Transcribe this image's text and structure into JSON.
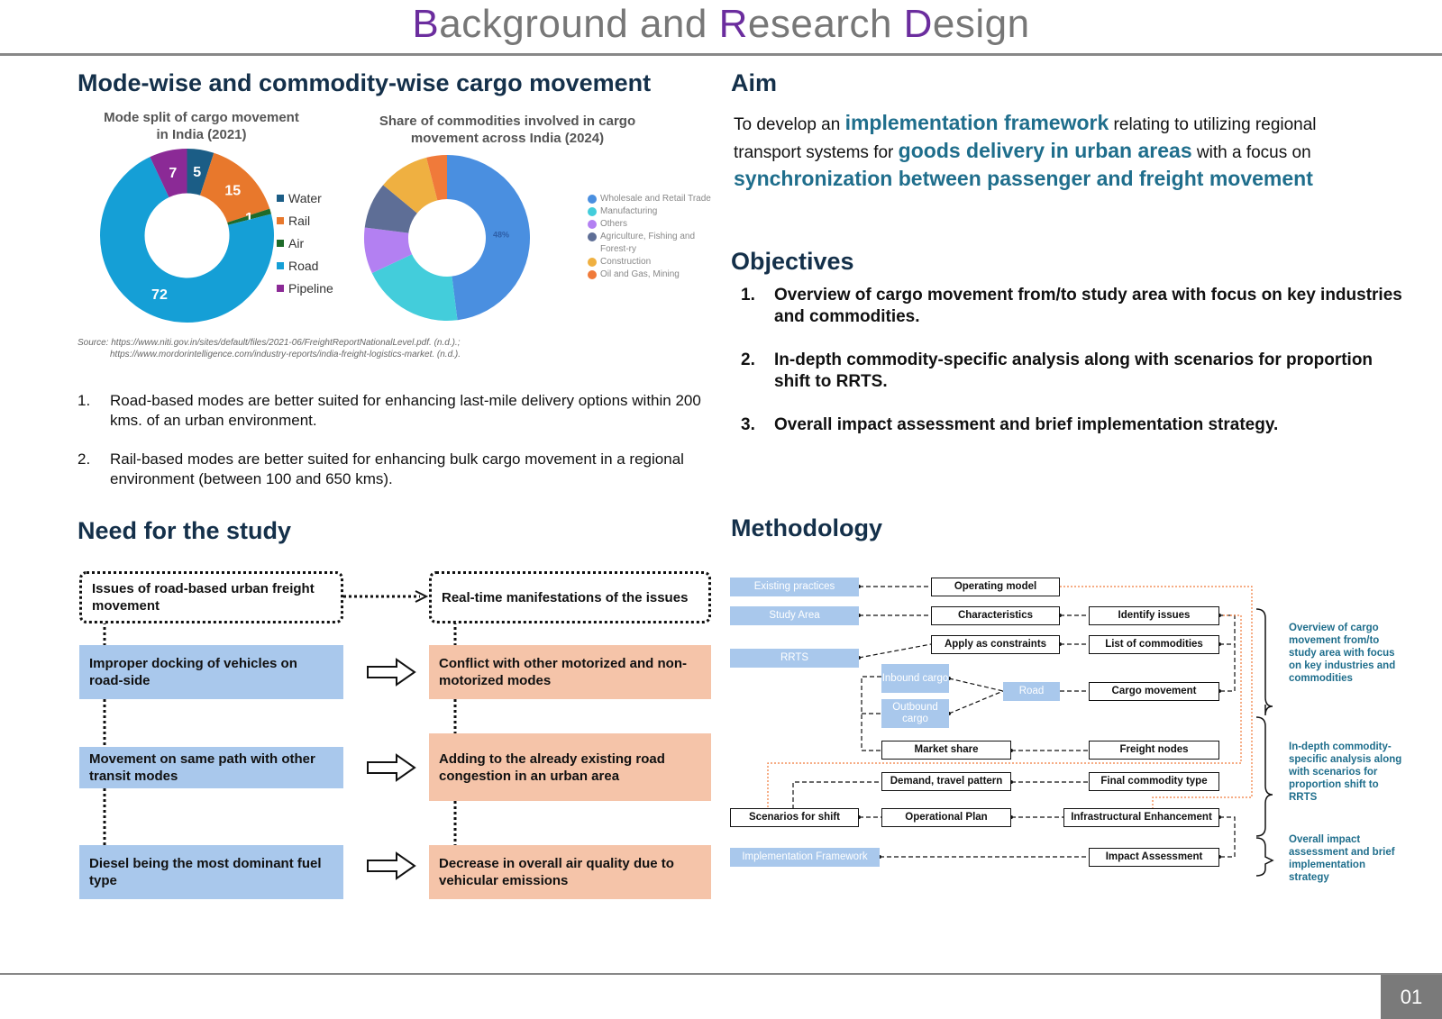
{
  "header": {
    "title_parts": [
      {
        "t": "B",
        "accent": true
      },
      {
        "t": "ackground and ",
        "accent": false
      },
      {
        "t": "R",
        "accent": true
      },
      {
        "t": "esearch ",
        "accent": false
      },
      {
        "t": "D",
        "accent": true
      },
      {
        "t": "esign",
        "accent": false
      }
    ]
  },
  "left_top": {
    "heading": "Mode-wise and commodity-wise cargo movement",
    "source_line1": "Source: https://www.niti.gov.in/sites/default/files/2021-06/FreightReportNationalLevel.pdf. (n.d.).;",
    "source_line2": "https://www.mordorintelligence.com/industry-reports/india-freight-logistics-market. (n.d.).",
    "points": [
      {
        "num": "1.",
        "text": "Road-based modes are better suited for enhancing last-mile delivery options within 200 kms. of an urban environment."
      },
      {
        "num": "2.",
        "text": "Rail-based modes are better suited for enhancing bulk cargo movement in a regional environment (between 100 and 650 kms)."
      }
    ]
  },
  "chart_data": [
    {
      "type": "pie",
      "title_line1": "Mode split of cargo movement",
      "title_line2": "in India (2021)",
      "categories": [
        "Water",
        "Rail",
        "Air",
        "Road",
        "Pipeline"
      ],
      "values": [
        5,
        15,
        1,
        72,
        7
      ],
      "labels": [
        "5",
        "15",
        "1",
        "72",
        "7"
      ],
      "colors": [
        "#1b5d86",
        "#e8782c",
        "#1e6b2a",
        "#159fd6",
        "#8b2a96"
      ],
      "legend_position": "right"
    },
    {
      "type": "pie",
      "title_line1": "Share of commodities involved in cargo",
      "title_line2": "movement across India (2024)",
      "categories": [
        "Wholesale and Retail Trade",
        "Manufacturing",
        "Others",
        "Agriculture, Fishing and Forest-ry",
        "Construction",
        "Oil and Gas, Mining"
      ],
      "values": [
        48,
        20,
        9,
        9,
        10,
        4
      ],
      "labels": [
        "48%",
        "",
        "",
        "",
        "",
        ""
      ],
      "colors": [
        "#4a8fe0",
        "#43cddb",
        "#b380f2",
        "#5e6e96",
        "#efb041",
        "#f07a3a"
      ],
      "legend_position": "right"
    }
  ],
  "need": {
    "heading": "Need for the study",
    "left_header": "Issues of road-based urban freight movement",
    "right_header": "Real-time manifestations of the issues",
    "rows": [
      {
        "issue": "Improper docking of vehicles on road-side",
        "effect": "Conflict with other motorized and non-motorized modes"
      },
      {
        "issue": "Movement on same path with other transit modes",
        "effect": "Adding to the already existing road congestion in an urban area"
      },
      {
        "issue": "Diesel being the most dominant fuel type",
        "effect": "Decrease in overall air quality due to vehicular emissions"
      }
    ]
  },
  "aim": {
    "heading": "Aim",
    "p1": "To develop an ",
    "h1": "implementation framework",
    "p2": " relating to utilizing regional transport systems for ",
    "h2": "goods delivery in urban areas",
    "p3": " with a focus on ",
    "h3": "synchronization between passenger and freight movement"
  },
  "objectives": {
    "heading": "Objectives",
    "items": [
      {
        "num": "1.",
        "text": "Overview of cargo movement from/to study area with focus on key industries and commodities."
      },
      {
        "num": "2.",
        "text": "In-depth commodity-specific analysis along with scenarios for proportion shift to RRTS."
      },
      {
        "num": "3.",
        "text": "Overall impact assessment and brief implementation strategy."
      }
    ]
  },
  "methodology": {
    "heading": "Methodology",
    "inputs": {
      "existing_practices": "Existing practices",
      "study_area": "Study Area",
      "rrts": "RRTS",
      "inbound": "Inbound cargo",
      "outbound": "Outbound cargo",
      "road": "Road",
      "implementation_framework": "Implementation Framework"
    },
    "steps": {
      "operating_model": "Operating model",
      "characteristics": "Characteristics",
      "identify_issues": "Identify issues",
      "apply_constraints": "Apply as constraints",
      "list_commodities": "List of commodities",
      "cargo_movement": "Cargo movement",
      "market_share": "Market share",
      "freight_nodes": "Freight nodes",
      "demand_pattern": "Demand, travel pattern",
      "final_commodity": "Final commodity type",
      "scenarios_shift": "Scenarios for shift",
      "operational_plan": "Operational Plan",
      "infra_enhancement": "Infrastructural Enhancement",
      "impact_assessment": "Impact Assessment"
    },
    "notes": [
      "Overview of cargo movement from/to study area with focus on key industries and commodities",
      "In-depth commodity-specific analysis along with scenarios for proportion shift to RRTS",
      "Overall impact assessment and brief implementation strategy"
    ]
  },
  "footer": {
    "page_number": "01"
  }
}
